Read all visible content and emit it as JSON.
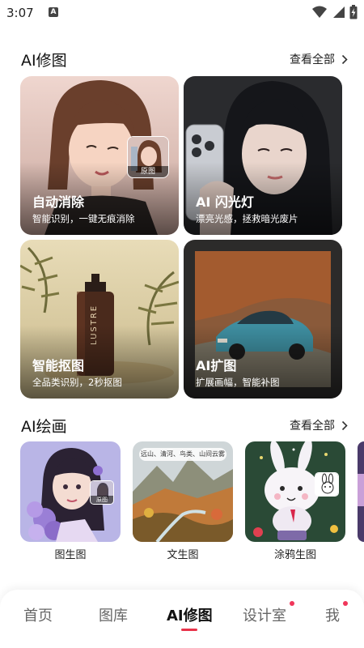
{
  "status_bar": {
    "time": "3:07",
    "notification_glyph": "A",
    "icons": [
      "wifi-icon",
      "signal-icon",
      "battery-charging-icon"
    ]
  },
  "ai_retouch": {
    "title": "AI修图",
    "see_all": "查看全部",
    "cards": [
      {
        "title": "自动消除",
        "subtitle": "智能识别，一键无痕消除",
        "badge": "原图"
      },
      {
        "title": "AI 闪光灯",
        "subtitle": "漂亮光感，拯救暗光废片"
      },
      {
        "title": "智能抠图",
        "subtitle": "全品类识别，2秒抠图",
        "product_text": "LUSTRE"
      },
      {
        "title": "AI扩图",
        "subtitle": "扩展画幅，智能补图"
      }
    ]
  },
  "ai_painting": {
    "title": "AI绘画",
    "see_all": "查看全部",
    "tiles": [
      {
        "label": "图生图",
        "badge": "原图"
      },
      {
        "label": "文生图",
        "prompt": "远山、清河、鸟类、山间云雾"
      },
      {
        "label": "涂鸦生图"
      }
    ]
  },
  "bottom_nav": {
    "items": [
      {
        "label": "首页"
      },
      {
        "label": "图库"
      },
      {
        "label": "AI修图",
        "active": true
      },
      {
        "label": "设计室",
        "dot": true
      },
      {
        "label": "我",
        "dot": true
      }
    ],
    "accent": "#e8334a"
  }
}
